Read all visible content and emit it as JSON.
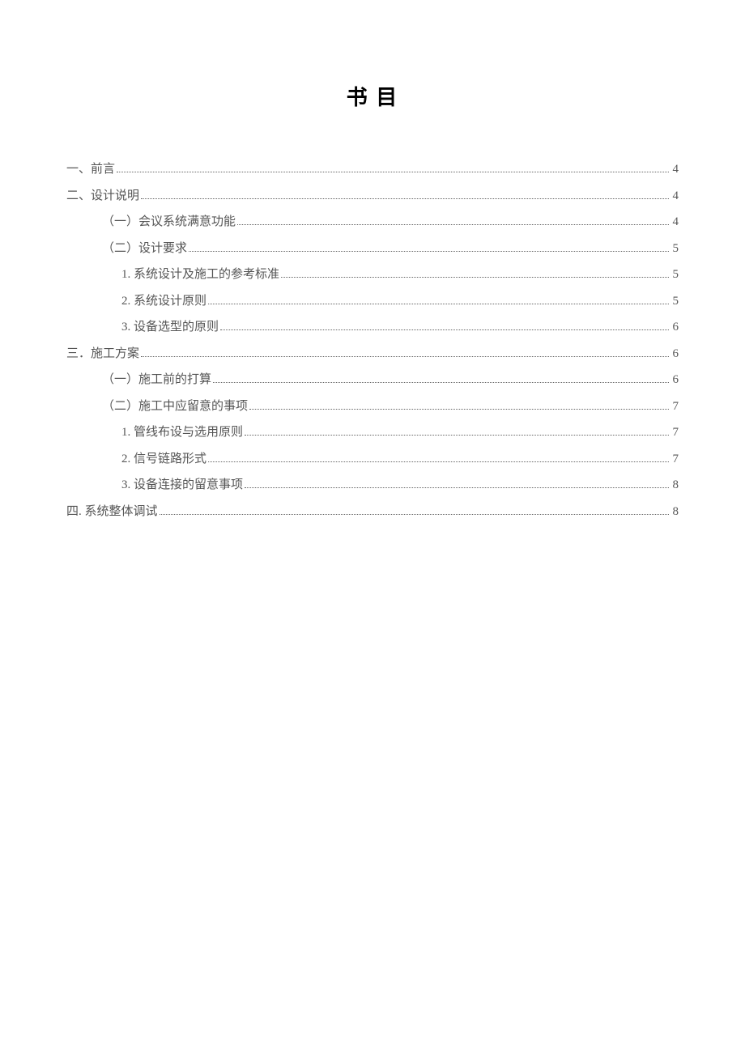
{
  "title": "书 目",
  "entries": [
    {
      "level": 0,
      "label": "一、前言",
      "page": "4"
    },
    {
      "level": 0,
      "label": "二、设计说明",
      "page": "4"
    },
    {
      "level": 1,
      "label": "（一）会议系统满意功能",
      "page": "4"
    },
    {
      "level": 1,
      "label": "（二）设计要求",
      "page": "5"
    },
    {
      "level": 2,
      "label": "1. 系统设计及施工的参考标准",
      "page": "5"
    },
    {
      "level": 2,
      "label": "2. 系统设计原则",
      "page": "5"
    },
    {
      "level": 2,
      "label": "3. 设备选型的原则",
      "page": "6"
    },
    {
      "level": 0,
      "label": "三．施工方案",
      "page": "6"
    },
    {
      "level": 1,
      "label": "（一）施工前的打算",
      "page": "6"
    },
    {
      "level": 1,
      "label": "（二）施工中应留意的事项",
      "page": "7"
    },
    {
      "level": 2,
      "label": "1. 管线布设与选用原则",
      "page": "7"
    },
    {
      "level": 2,
      "label": "2. 信号链路形式",
      "page": "7"
    },
    {
      "level": 2,
      "label": "3. 设备连接的留意事项",
      "page": "8"
    },
    {
      "level": 0,
      "label": "四. 系统整体调试",
      "page": "8"
    }
  ]
}
